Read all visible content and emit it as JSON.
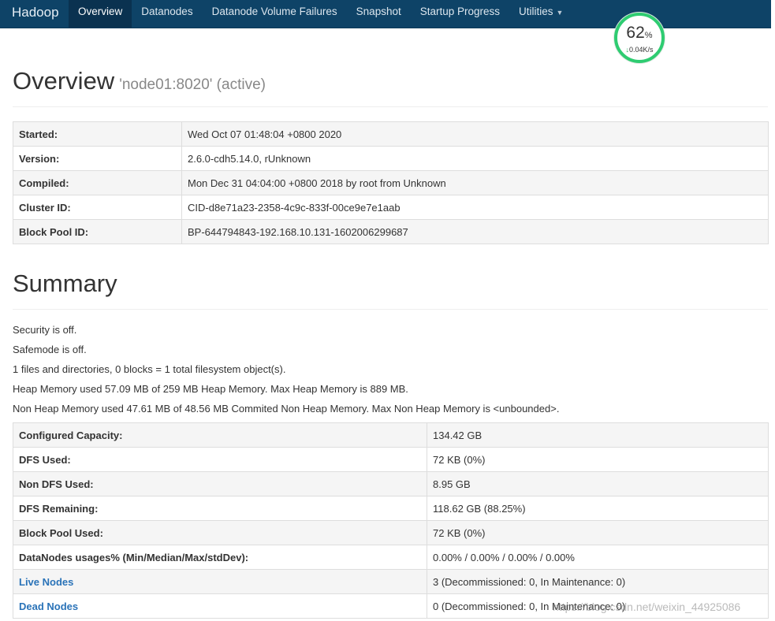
{
  "nav": {
    "brand": "Hadoop",
    "items": [
      "Overview",
      "Datanodes",
      "Datanode Volume Failures",
      "Snapshot",
      "Startup Progress",
      "Utilities"
    ]
  },
  "widget": {
    "percent": "62",
    "percent_unit": "%",
    "speed": "0.04K/s",
    "arrow": "↓"
  },
  "overview": {
    "title": "Overview",
    "subtitle": "'node01:8020' (active)",
    "rows": [
      {
        "key": "Started:",
        "value": "Wed Oct 07 01:48:04 +0800 2020"
      },
      {
        "key": "Version:",
        "value": "2.6.0-cdh5.14.0, rUnknown"
      },
      {
        "key": "Compiled:",
        "value": "Mon Dec 31 04:04:00 +0800 2018 by root from Unknown"
      },
      {
        "key": "Cluster ID:",
        "value": "CID-d8e71a23-2358-4c9c-833f-00ce9e7e1aab"
      },
      {
        "key": "Block Pool ID:",
        "value": "BP-644794843-192.168.10.131-1602006299687"
      }
    ]
  },
  "summary": {
    "title": "Summary",
    "lines": [
      "Security is off.",
      "Safemode is off.",
      "1 files and directories, 0 blocks = 1 total filesystem object(s).",
      "Heap Memory used 57.09 MB of 259 MB Heap Memory. Max Heap Memory is 889 MB.",
      "Non Heap Memory used 47.61 MB of 48.56 MB Commited Non Heap Memory. Max Non Heap Memory is <unbounded>."
    ],
    "rows": [
      {
        "key": "Configured Capacity:",
        "value": "134.42 GB"
      },
      {
        "key": "DFS Used:",
        "value": "72 KB (0%)"
      },
      {
        "key": "Non DFS Used:",
        "value": "8.95 GB"
      },
      {
        "key": "DFS Remaining:",
        "value": "118.62 GB (88.25%)"
      },
      {
        "key": "Block Pool Used:",
        "value": "72 KB (0%)"
      },
      {
        "key": "DataNodes usages% (Min/Median/Max/stdDev):",
        "value": "0.00% / 0.00% / 0.00% / 0.00%"
      },
      {
        "key": "Live Nodes",
        "value": "3 (Decommissioned: 0, In Maintenance: 0)"
      },
      {
        "key": "Dead Nodes",
        "value": "0 (Decommissioned: 0, In Maintenance: 0)"
      }
    ]
  },
  "watermark": "https://blog.csdn.net/weixin_44925086"
}
